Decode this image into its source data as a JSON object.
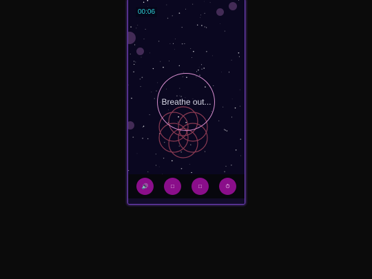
{
  "timer": {
    "elapsed": "00:06"
  },
  "breath": {
    "instruction": "Breathe out..."
  },
  "toolbar": {
    "buttons": [
      {
        "name": "sound-button",
        "icon": "sound-icon",
        "glyph": "🔊"
      },
      {
        "name": "option-button-1",
        "icon": "square-icon",
        "glyph": "□"
      },
      {
        "name": "option-button-2",
        "icon": "square-icon",
        "glyph": "□"
      },
      {
        "name": "timer-button",
        "icon": "timer-icon",
        "glyph": "⏱"
      }
    ]
  },
  "colors": {
    "accent": "#8a0e8a",
    "timer_text": "#2dd4d9",
    "circle_stroke": "#d98fd0",
    "flower_stroke": "#8a3a52",
    "frame": "#6f3fb8",
    "background": "#0a0720"
  }
}
